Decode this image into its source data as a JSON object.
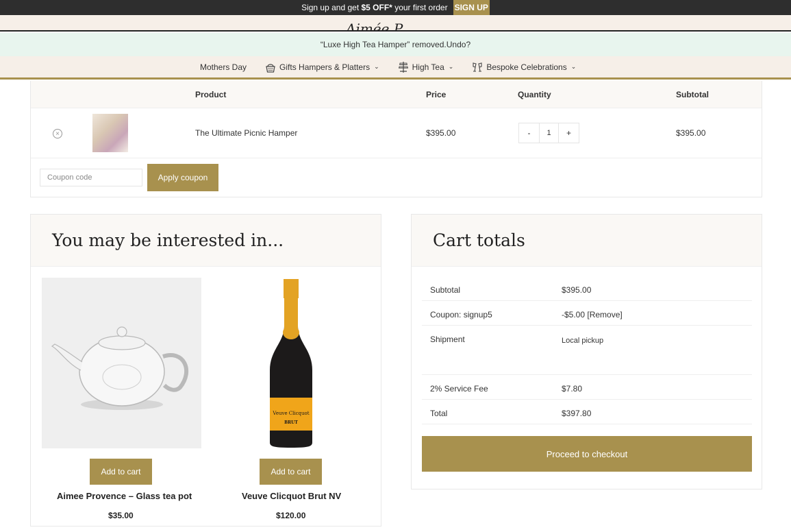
{
  "topbar": {
    "text_pre": "Sign up and get",
    "offer": "$5 OFF*",
    "text_post": "your first order",
    "signup": "SIGN UP"
  },
  "logo": {
    "script": "Aimée P"
  },
  "notice": {
    "text": "“Luxe High Tea Hamper” removed.",
    "undo": "Undo?"
  },
  "nav": {
    "items": [
      {
        "label": "Mothers Day",
        "icon": ""
      },
      {
        "label": "Gifts Hampers & Platters",
        "icon": "hamper-icon"
      },
      {
        "label": "High Tea",
        "icon": "cake-stand-icon"
      },
      {
        "label": "Bespoke Celebrations",
        "icon": "champagne-glasses-icon"
      }
    ]
  },
  "cart": {
    "headers": {
      "product": "Product",
      "price": "Price",
      "quantity": "Quantity",
      "subtotal": "Subtotal"
    },
    "item": {
      "name": "The Ultimate Picnic Hamper",
      "price": "$395.00",
      "qty": "1",
      "subtotal": "$395.00",
      "minus": "-",
      "plus": "+"
    },
    "coupon_placeholder": "Coupon code",
    "apply": "Apply coupon"
  },
  "interested": {
    "title": "You may be interested in...",
    "products": [
      {
        "name": "Aimee Provence – Glass tea pot",
        "price": "$35.00",
        "button": "Add to cart"
      },
      {
        "name": "Veuve Clicquot Brut NV",
        "price": "$120.00",
        "button": "Add to cart"
      }
    ]
  },
  "totals": {
    "title": "Cart totals",
    "subtotal_label": "Subtotal",
    "subtotal": "$395.00",
    "coupon_label": "Coupon: signup5",
    "coupon": "-$5.00",
    "coupon_remove": "[Remove]",
    "shipment_label": "Shipment",
    "shipment": "Local pickup",
    "fee_label": "2% Service Fee",
    "fee": "$7.80",
    "total_label": "Total",
    "total": "$397.80",
    "checkout": "Proceed to checkout"
  },
  "bottle_label": {
    "brand": "Veuve Clicquot",
    "type": "BRUT"
  },
  "colors": {
    "accent": "#a8914e",
    "topbar": "#2e2e2e",
    "notice_bg": "#e8f5ee"
  }
}
